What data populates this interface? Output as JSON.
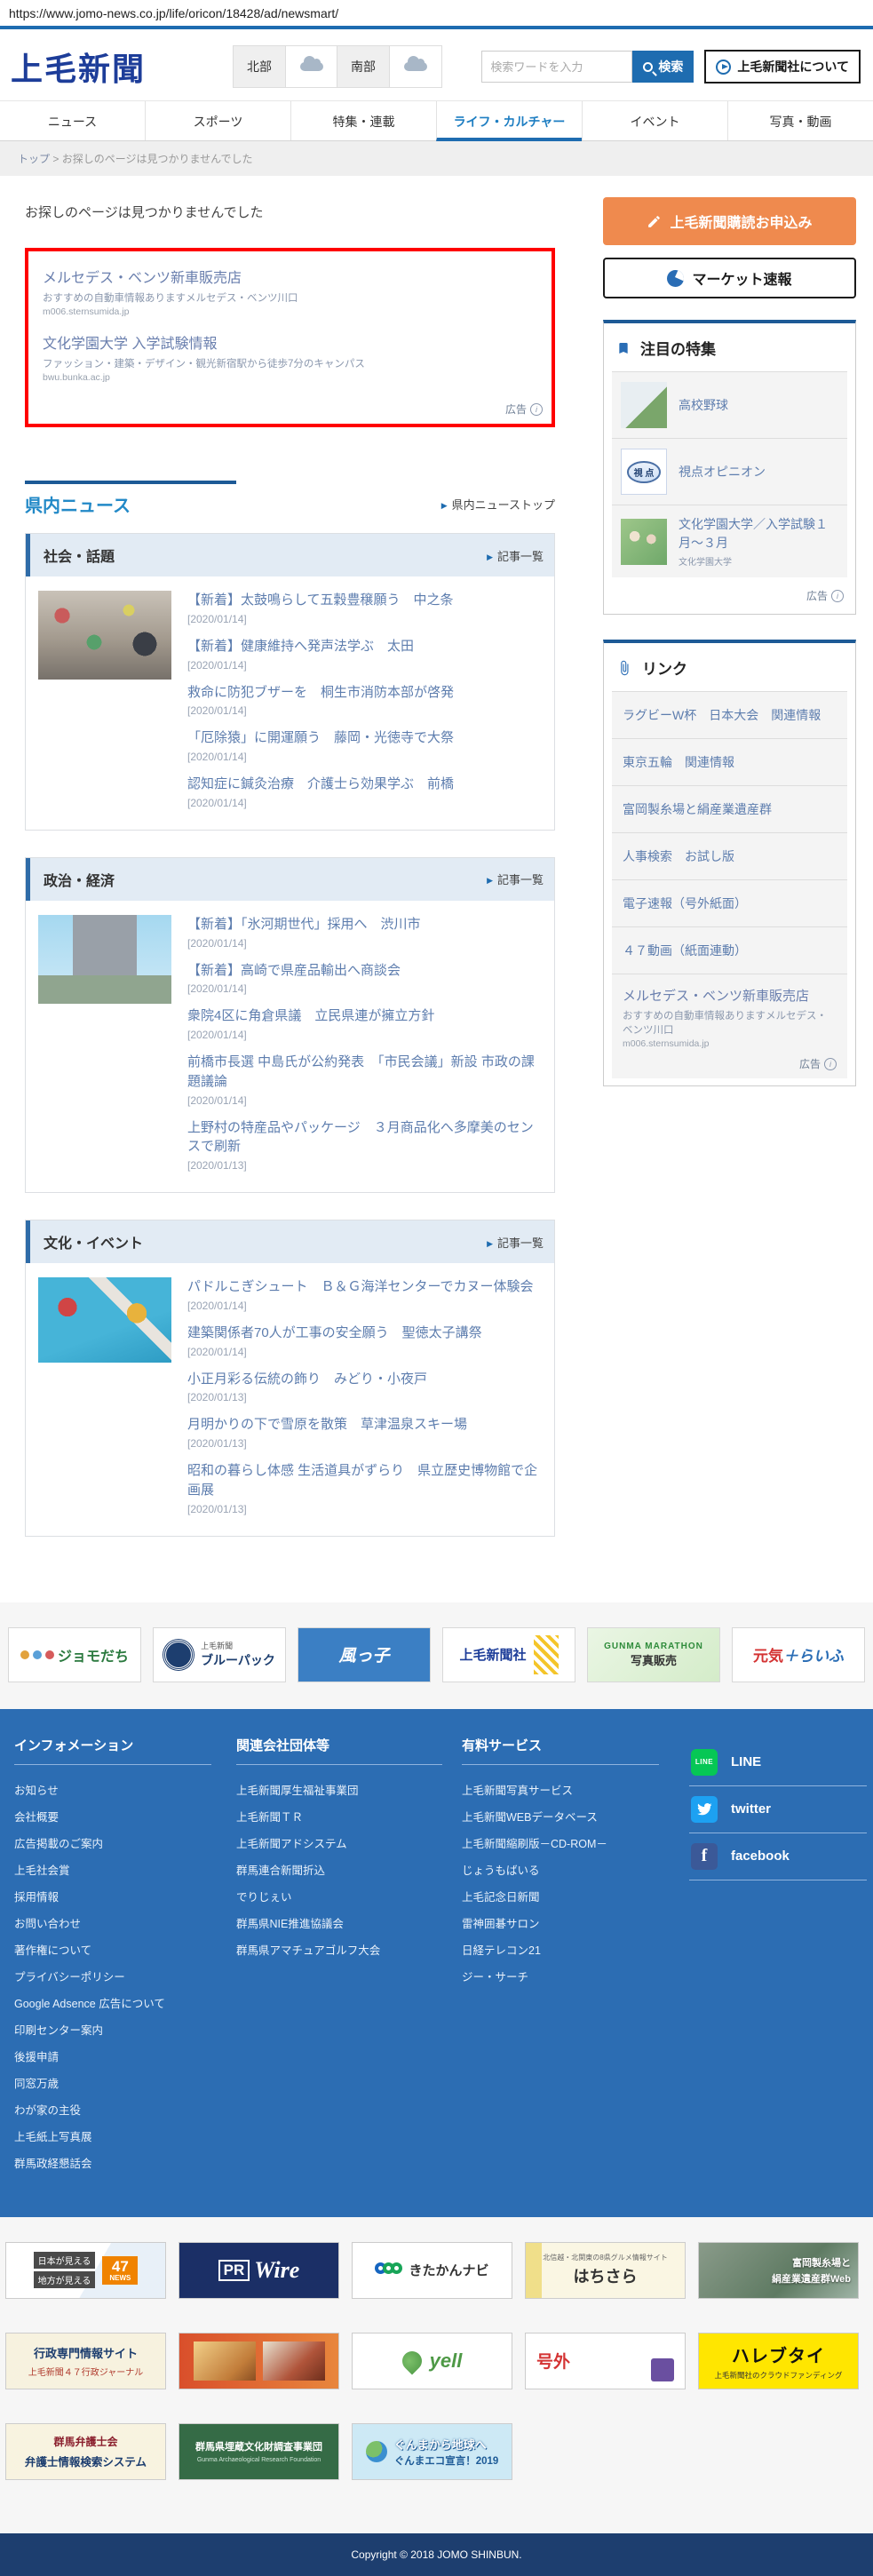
{
  "page": {
    "url": "https://www.jomo-news.co.jp/life/oricon/18428/ad/newsmart/"
  },
  "header": {
    "logo": "上毛新聞",
    "weather": {
      "north": "北部",
      "south": "南部"
    },
    "search_placeholder": "検索ワードを入力",
    "search_button": "検索",
    "about_button": "上毛新聞社について"
  },
  "nav": {
    "items": [
      {
        "label": "ニュース"
      },
      {
        "label": "スポーツ"
      },
      {
        "label": "特集・連載"
      },
      {
        "label": "ライフ・カルチャー"
      },
      {
        "label": "イベント"
      },
      {
        "label": "写真・動画"
      }
    ]
  },
  "breadcrumb": {
    "home": "トップ",
    "separator": ">",
    "current": "お探しのページは見つかりませんでした"
  },
  "main": {
    "not_found": "お探しのページは見つかりませんでした",
    "ad_label": "広告",
    "top_ads": [
      {
        "title": "メルセデス・ベンツ新車販売店",
        "desc": "おすすめの自動車情報ありますメルセデス・ベンツ川口",
        "url": "m006.sternsumida.jp"
      },
      {
        "title": "文化学園大学 入学試験情報",
        "desc": "ファッション・建築・デザイン・観光新宿駅から徒歩7分のキャンパス",
        "url": "bwu.bunka.ac.jp"
      }
    ],
    "section_title": "県内ニュース",
    "section_top_link": "県内ニューストップ",
    "subsections": [
      {
        "title": "社会・話題",
        "more": "記事一覧",
        "articles": [
          {
            "title": "【新着】太鼓鳴らして五穀豊穣願う　中之条",
            "date": "[2020/01/14]"
          },
          {
            "title": "【新着】健康維持へ発声法学ぶ　太田",
            "date": "[2020/01/14]"
          },
          {
            "title": "救命に防犯ブザーを　桐生市消防本部が啓発",
            "date": "[2020/01/14]"
          },
          {
            "title": "「厄除猿」に開運願う　藤岡・光徳寺で大祭",
            "date": "[2020/01/14]"
          },
          {
            "title": "認知症に鍼灸治療　介護士ら効果学ぶ　前橋",
            "date": "[2020/01/14]"
          }
        ]
      },
      {
        "title": "政治・経済",
        "more": "記事一覧",
        "articles": [
          {
            "title": "【新着】「氷河期世代」採用へ　渋川市",
            "date": "[2020/01/14]"
          },
          {
            "title": "【新着】高崎で県産品輸出へ商談会",
            "date": "[2020/01/14]"
          },
          {
            "title": "衆院4区に角倉県議　立民県連が擁立方針",
            "date": "[2020/01/14]"
          },
          {
            "title": "前橋市長選 中島氏が公約発表　「市民会議」新設 市政の課題議論",
            "date": "[2020/01/14]"
          },
          {
            "title": "上野村の特産品やパッケージ　３月商品化へ多摩美のセンスで刷新",
            "date": "[2020/01/13]"
          }
        ]
      },
      {
        "title": "文化・イベント",
        "more": "記事一覧",
        "articles": [
          {
            "title": "パドルこぎシュート　Ｂ＆Ｇ海洋センターでカヌー体験会",
            "date": "[2020/01/14]"
          },
          {
            "title": "建築関係者70人が工事の安全願う　聖徳太子講祭",
            "date": "[2020/01/14]"
          },
          {
            "title": "小正月彩る伝統の飾り　みどり・小夜戸",
            "date": "[2020/01/13]"
          },
          {
            "title": "月明かりの下で雪原を散策　草津温泉スキー場",
            "date": "[2020/01/13]"
          },
          {
            "title": "昭和の暮らし体感 生活道具がずらり　県立歴史博物館で企画展",
            "date": "[2020/01/13]"
          }
        ]
      }
    ]
  },
  "sidebar": {
    "subscribe": "上毛新聞購読お申込み",
    "market": "マーケット速報",
    "featured": {
      "title": "注目の特集",
      "items": [
        {
          "label": "高校野球"
        },
        {
          "label": "視点オピニオン",
          "thumb": "視 点"
        },
        {
          "label": "文化学園大学／入学試験１月～３月",
          "sub": "文化学園大学"
        }
      ],
      "ad_label": "広告"
    },
    "links": {
      "title": "リンク",
      "items": [
        {
          "label": "ラグビーW杯　日本大会　関連情報"
        },
        {
          "label": "東京五輪　関連情報"
        },
        {
          "label": "富岡製糸場と絹産業遺産群"
        },
        {
          "label": "人事検索　お試し版"
        },
        {
          "label": "電子速報（号外紙面）"
        },
        {
          "label": "４７動画（紙面連動）"
        }
      ],
      "ad": {
        "title": "メルセデス・ベンツ新車販売店",
        "desc": "おすすめの自動車情報ありますメルセデス・ベンツ川口",
        "url": "m006.sternsumida.jp",
        "ad_label": "広告"
      }
    }
  },
  "partners": {
    "items": [
      {
        "label": "ジョモだち"
      },
      {
        "label": "ブルーパック",
        "sub": "上毛新聞"
      },
      {
        "label": "風っ子"
      },
      {
        "label": "上毛新聞社"
      },
      {
        "label": "写真販売",
        "sub": "GUNMA MARATHON"
      },
      {
        "label": "元気",
        "label2": "＋らいふ"
      }
    ]
  },
  "footer": {
    "columns": [
      {
        "title": "インフォメーション",
        "links": [
          "お知らせ",
          "会社概要",
          "広告掲載のご案内",
          "上毛社会賞",
          "採用情報",
          "お問い合わせ",
          "著作権について",
          "プライバシーポリシー",
          "Google Adsence 広告について",
          "印刷センター案内",
          "後援申請",
          "同窓万歳",
          "わが家の主役",
          "上毛紙上写真展",
          "群馬政経懇話会"
        ]
      },
      {
        "title": "関連会社団体等",
        "links": [
          "上毛新聞厚生福祉事業団",
          "上毛新聞ＴＲ",
          "上毛新聞アドシステム",
          "群馬連合新聞折込",
          "でりじぇい",
          "群馬県NIE推進協議会",
          "群馬県アマチュアゴルフ大会"
        ]
      },
      {
        "title": "有料サービス",
        "links": [
          "上毛新聞写真サービス",
          "上毛新聞WEBデータベース",
          "上毛新聞縮刷版－CD-ROM－",
          "じょうもばいる",
          "上毛記念日新聞",
          "雷神囲碁サロン",
          "日経テレコン21",
          "ジー・サーチ"
        ]
      }
    ],
    "social": [
      {
        "label": "LINE",
        "icon_text": "LINE"
      },
      {
        "label": "twitter"
      },
      {
        "label": "facebook",
        "icon_text": "f"
      }
    ],
    "copyright": "Copyright © 2018 JOMO SHINBUN."
  },
  "bottom_ads": {
    "row1": [
      {
        "line1": "日本が見える",
        "line2": "地方が見える",
        "badge_num": "47",
        "badge_text": "NEWS"
      },
      {
        "pr": "PR",
        "wire": "Wire"
      },
      {
        "label": "きたかんナビ"
      },
      {
        "top": "北信越・北関東の8県グルメ情報サイト",
        "label": "はちさら"
      },
      {
        "line1": "富岡製糸場と",
        "line2": "絹産業遺産群Web"
      }
    ],
    "row2": [
      {
        "line1": "行政専門情報サイト",
        "line2": "上毛新聞４７行政ジャーナル"
      },
      {},
      {
        "label": "yell"
      },
      {
        "label": "号外"
      },
      {
        "label": "ハレブタイ",
        "sub": "上毛新聞社のクラウドファンディング"
      }
    ],
    "row3": [
      {
        "line1": "群馬弁護士会",
        "line2": "弁護士情報検索システム"
      },
      {
        "line1": "群馬県埋蔵文化財調査事業団",
        "line2": "Gunma Archaeological Research Foundation"
      },
      {
        "line1": "ぐんまから地球へ",
        "line2": "ぐんまエコ宣言！2019"
      }
    ]
  }
}
